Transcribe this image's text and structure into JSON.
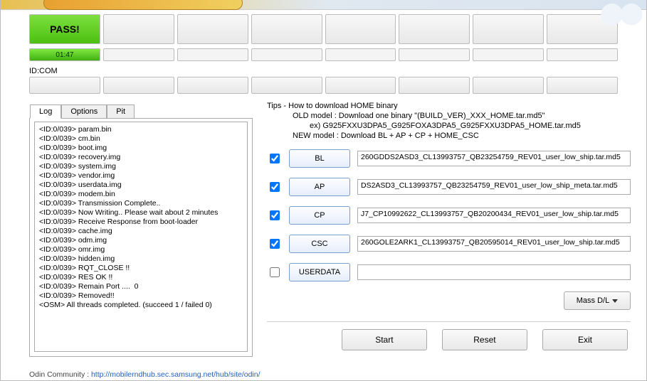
{
  "status": {
    "pass_label": "PASS!",
    "time": "01:47"
  },
  "idcom_label": "ID:COM",
  "tabs": {
    "log": "Log",
    "options": "Options",
    "pit": "Pit"
  },
  "log_lines": [
    "<ID:0/039> param.bin",
    "<ID:0/039> cm.bin",
    "<ID:0/039> boot.img",
    "<ID:0/039> recovery.img",
    "<ID:0/039> system.img",
    "<ID:0/039> vendor.img",
    "<ID:0/039> userdata.img",
    "<ID:0/039> modem.bin",
    "<ID:0/039> Transmission Complete..",
    "<ID:0/039> Now Writing.. Please wait about 2 minutes",
    "<ID:0/039> Receive Response from boot-loader",
    "<ID:0/039> cache.img",
    "<ID:0/039> odm.img",
    "<ID:0/039> omr.img",
    "<ID:0/039> hidden.img",
    "<ID:0/039> RQT_CLOSE !!",
    "<ID:0/039> RES OK !!",
    "<ID:0/039> Remain Port ....  0",
    "<ID:0/039> Removed!!",
    "<OSM> All threads completed. (succeed 1 / failed 0)"
  ],
  "tips": {
    "title": "Tips - How to download HOME binary",
    "old": "OLD model  : Download one binary    \"(BUILD_VER)_XXX_HOME.tar.md5\"",
    "ex": "ex) G925FXXU3DPA5_G925FOXA3DPA5_G925FXXU3DPA5_HOME.tar.md5",
    "new": "NEW model : Download BL + AP + CP + HOME_CSC"
  },
  "files": {
    "bl": {
      "label": "BL",
      "checked": true,
      "path": "260GDDS2ASD3_CL13993757_QB23254759_REV01_user_low_ship.tar.md5"
    },
    "ap": {
      "label": "AP",
      "checked": true,
      "path": "DS2ASD3_CL13993757_QB23254759_REV01_user_low_ship_meta.tar.md5"
    },
    "cp": {
      "label": "CP",
      "checked": true,
      "path": "J7_CP10992622_CL13993757_QB20200434_REV01_user_low_ship.tar.md5"
    },
    "csc": {
      "label": "CSC",
      "checked": true,
      "path": "260GOLE2ARK1_CL13993757_QB20595014_REV01_user_low_ship.tar.md5"
    },
    "userdata": {
      "label": "USERDATA",
      "checked": false,
      "path": ""
    }
  },
  "buttons": {
    "massdl": "Mass D/L",
    "start": "Start",
    "reset": "Reset",
    "exit": "Exit"
  },
  "footer": {
    "prefix": "Odin Community : ",
    "link": "http://mobilerndhub.sec.samsung.net/hub/site/odin/"
  }
}
